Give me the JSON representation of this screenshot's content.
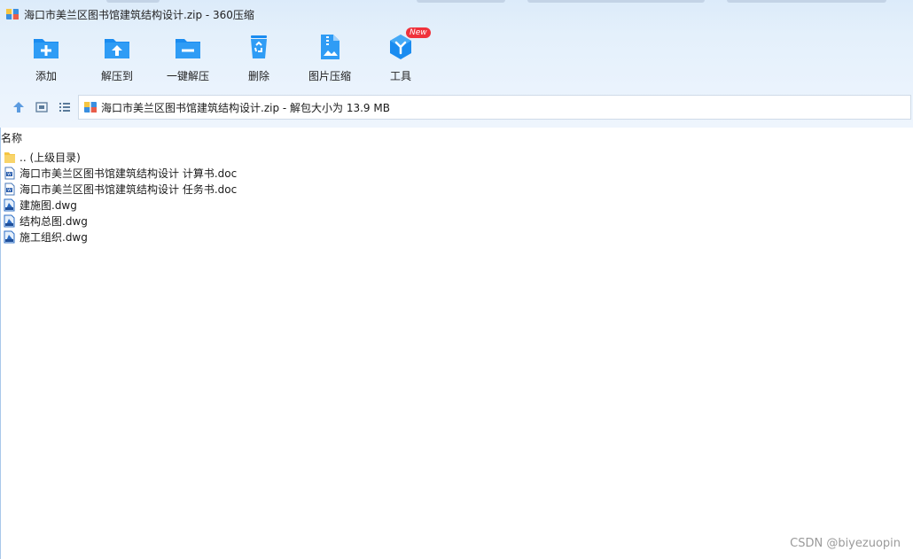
{
  "window": {
    "title": "海口市美兰区图书馆建筑结构设计.zip - 360压缩",
    "app_icon": "archive-icon"
  },
  "toolbar": {
    "items": [
      {
        "label": "添加",
        "icon": "add-folder-icon"
      },
      {
        "label": "解压到",
        "icon": "extract-folder-icon"
      },
      {
        "label": "一键解压",
        "icon": "quick-extract-icon"
      },
      {
        "label": "删除",
        "icon": "recycle-bin-icon"
      },
      {
        "label": "图片压缩",
        "icon": "image-compress-icon"
      },
      {
        "label": "工具",
        "icon": "tools-cube-icon",
        "badge": "New"
      }
    ]
  },
  "navigation": {
    "up_icon": "up-arrow-icon",
    "thumbnail_view_icon": "thumbnail-view-icon",
    "list_view_icon": "list-view-icon"
  },
  "address": {
    "text": "海口市美兰区图书馆建筑结构设计.zip - 解包大小为 13.9 MB"
  },
  "file_list": {
    "column_name": "名称",
    "rows": [
      {
        "name": ".. (上级目录)",
        "type": "parent-folder"
      },
      {
        "name": "海口市美兰区图书馆建筑结构设计 计算书.doc",
        "type": "doc"
      },
      {
        "name": "海口市美兰区图书馆建筑结构设计 任务书.doc",
        "type": "doc"
      },
      {
        "name": "建施图.dwg",
        "type": "dwg"
      },
      {
        "name": "结构总图.dwg",
        "type": "dwg"
      },
      {
        "name": "施工组织.dwg",
        "type": "dwg"
      }
    ]
  },
  "watermark": "CSDN @biyezuopin",
  "colors": {
    "accent_blue": "#1a8cf0",
    "badge_red": "#f0323c",
    "folder_yellow": "#f5c542"
  }
}
